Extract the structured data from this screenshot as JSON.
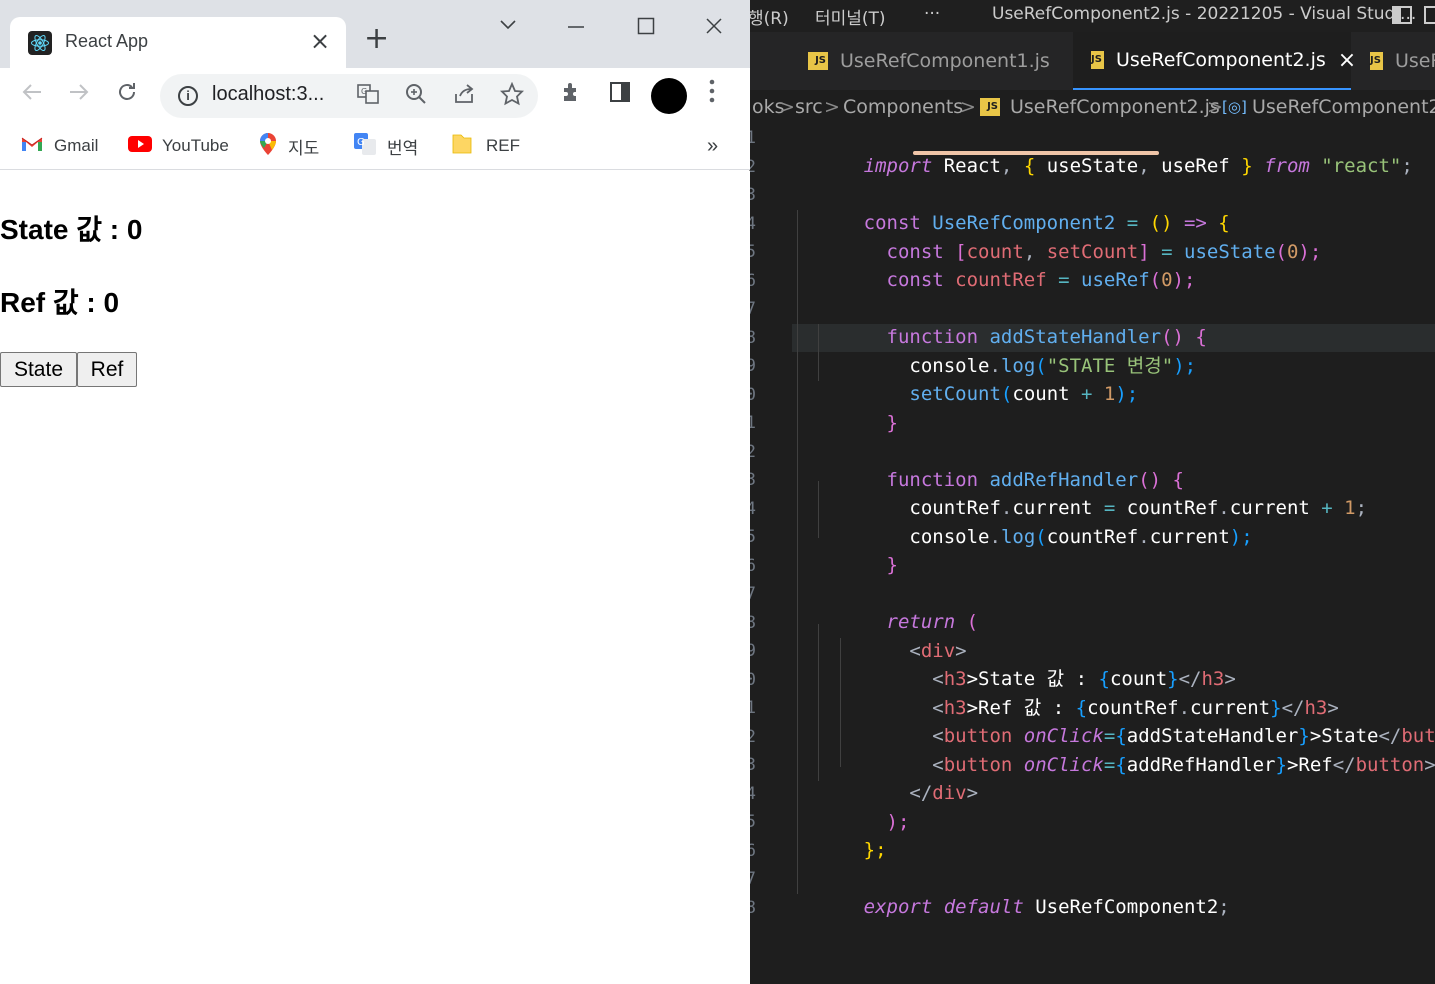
{
  "vscode": {
    "menu_run": "행(R)",
    "menu_terminal": "터미널(T)",
    "menu_more": "···",
    "window_title": "UseRefComponent2.js - 20221205 - Visual Studi...",
    "tabs": [
      {
        "label": "UseRefComponent1.js"
      },
      {
        "label": "UseRefComponent2.js",
        "close": "×"
      },
      {
        "label": "UseR"
      }
    ],
    "js_icon_text": "JS",
    "breadcrumb": {
      "part0": "oks",
      "part1": "src",
      "part2": "Components",
      "part3": "UseRefComponent2.js",
      "part4": "UseRefComponent2",
      "sep": ">",
      "symbol_icon": "[◎]"
    },
    "code": {
      "l1": {
        "a": "import",
        "b": " React",
        "c": ",",
        "d": " {",
        "e": " useState",
        "f": ",",
        "g": " useRef",
        "h": " }",
        "i": " from",
        "j": " \"react\"",
        "k": ";"
      },
      "l3": {
        "a": "const",
        "b": " UseRefComponent2",
        "c": " =",
        "d": " ()",
        "e": " =>",
        "f": " {"
      },
      "l4": {
        "a": "  const",
        "b": " [",
        "c": "count",
        "d": ",",
        "e": " setCount",
        "f": "]",
        "g": " =",
        "h": " useState",
        "i": "(",
        "j": "0",
        "k": ");"
      },
      "l5": {
        "a": "  const",
        "b": " countRef",
        "c": " =",
        "d": " useRef",
        "e": "(",
        "f": "0",
        "g": ");"
      },
      "l7": {
        "a": "  function",
        "b": " addStateHandler",
        "c": "()",
        "d": " {"
      },
      "l8": {
        "a": "    console",
        "b": ".",
        "c": "log",
        "d": "(",
        "e": "\"STATE 변경\"",
        "f": ");"
      },
      "l9": {
        "a": "    setCount",
        "b": "(",
        "c": "count",
        "d": " +",
        "e": " 1",
        "f": ");"
      },
      "l10": {
        "a": "  }"
      },
      "l12": {
        "a": "  function",
        "b": " addRefHandler",
        "c": "()",
        "d": " {"
      },
      "l13": {
        "a": "    countRef",
        "b": ".",
        "c": "current",
        "d": " =",
        "e": " countRef",
        "f": ".",
        "g": "current",
        "h": " +",
        "i": " 1",
        "j": ";"
      },
      "l14": {
        "a": "    console",
        "b": ".",
        "c": "log",
        "d": "(",
        "e": "countRef",
        "f": ".",
        "g": "current",
        "h": ");"
      },
      "l15": {
        "a": "  }"
      },
      "l17": {
        "a": "  return",
        "b": " ("
      },
      "l18": {
        "a": "    <",
        "b": "div",
        "c": ">"
      },
      "l19": {
        "a": "      <",
        "b": "h3",
        "c": ">State 값 : ",
        "d": "{",
        "e": "count",
        "f": "}",
        "g": "</",
        "h": "h3",
        "i": ">"
      },
      "l20": {
        "a": "      <",
        "b": "h3",
        "c": ">Ref 값 : ",
        "d": "{",
        "e": "countRef",
        "f": ".",
        "g": "current",
        "h": "}",
        "i": "</",
        "j": "h3",
        "k": ">"
      },
      "l21": {
        "a": "      <",
        "b": "button",
        "c": " onClick",
        "d": "=",
        "e": "{",
        "f": "addStateHandler",
        "g": "}",
        "h": ">State",
        "i": "</",
        "j": "button",
        "k": ">"
      },
      "l22": {
        "a": "      <",
        "b": "button",
        "c": " onClick",
        "d": "=",
        "e": "{",
        "f": "addRefHandler",
        "g": "}",
        "h": ">Ref",
        "i": "</",
        "j": "button",
        "k": ">"
      },
      "l23": {
        "a": "    </",
        "b": "div",
        "c": ">"
      },
      "l24": {
        "a": "  );"
      },
      "l25": {
        "a": "};"
      },
      "l27": {
        "a": "export",
        "b": " default",
        "c": " UseRefComponent2",
        "d": ";"
      }
    },
    "line_numbers": [
      "1",
      "2",
      "3",
      "4",
      "5",
      "6",
      "7",
      "8",
      "9",
      "0",
      "1",
      "2",
      "3",
      "4",
      "5",
      "6",
      "7",
      "8",
      "9",
      "0",
      "1",
      "2",
      "3",
      "4",
      "5",
      "6",
      "7",
      "8"
    ]
  },
  "chrome": {
    "tab_title": "React App",
    "tab_close": "×",
    "new_tab": "+",
    "url": "localhost:3...",
    "bookmarks": [
      {
        "label": "Gmail"
      },
      {
        "label": "YouTube"
      },
      {
        "label": "지도"
      },
      {
        "label": "번역"
      },
      {
        "label": "REF"
      }
    ],
    "bookmarks_more": "»"
  },
  "page": {
    "state_text": "State 값 : 0",
    "ref_text": "Ref 값 : 0",
    "state_button": "State",
    "ref_button": "Ref"
  },
  "colors": {
    "editor_bg": "#1e1e1e",
    "tab_active_border": "#3794ff",
    "js_icon": "#e8c547"
  }
}
